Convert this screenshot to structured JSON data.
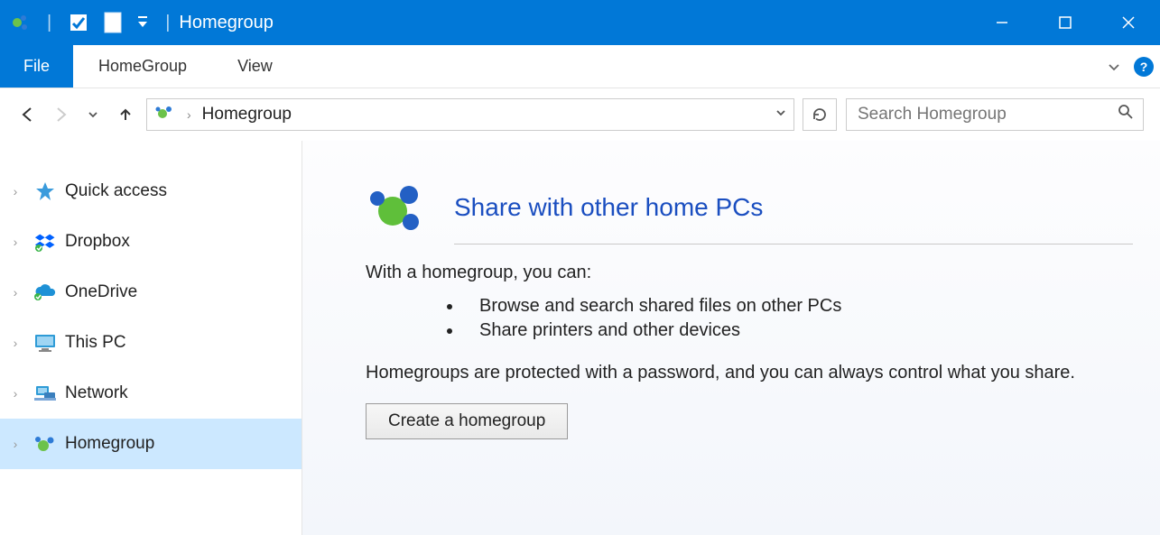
{
  "window": {
    "title": "Homegroup"
  },
  "ribbon": {
    "file": "File",
    "tabs": [
      "HomeGroup",
      "View"
    ]
  },
  "address": {
    "location": "Homegroup"
  },
  "search": {
    "placeholder": "Search Homegroup"
  },
  "sidebar": {
    "items": [
      {
        "label": "Quick access"
      },
      {
        "label": "Dropbox"
      },
      {
        "label": "OneDrive"
      },
      {
        "label": "This PC"
      },
      {
        "label": "Network"
      },
      {
        "label": "Homegroup"
      }
    ]
  },
  "content": {
    "heading": "Share with other home PCs",
    "intro": "With a homegroup, you can:",
    "bullets": [
      "Browse and search shared files on other PCs",
      "Share printers and other devices"
    ],
    "note": "Homegroups are protected with a password, and you can always control what you share.",
    "button": "Create a homegroup"
  }
}
